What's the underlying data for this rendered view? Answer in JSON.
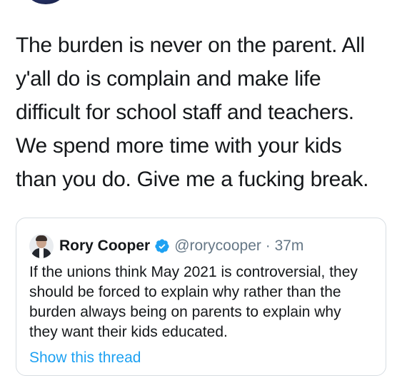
{
  "tweet": {
    "text": "The burden is never on the parent. All\ny'all do is complain and make life\ndifficult for school staff and teachers.\nWe spend more time with your kids\nthan you do. Give me a fucking break."
  },
  "quote": {
    "author_name": "Rory Cooper",
    "handle": "@rorycooper",
    "separator": "·",
    "time": "37m",
    "text": "If the unions think May 2021 is controversial, they should be forced to explain why rather than the burden always being on parents to explain why they want their kids educated.",
    "show_thread_label": "Show this thread",
    "verified_icon": "verified-badge-icon"
  },
  "colors": {
    "text_primary": "#14171a",
    "text_secondary": "#657786",
    "link": "#1da1f2",
    "verified": "#1da1f2",
    "border": "#d7dde2"
  }
}
